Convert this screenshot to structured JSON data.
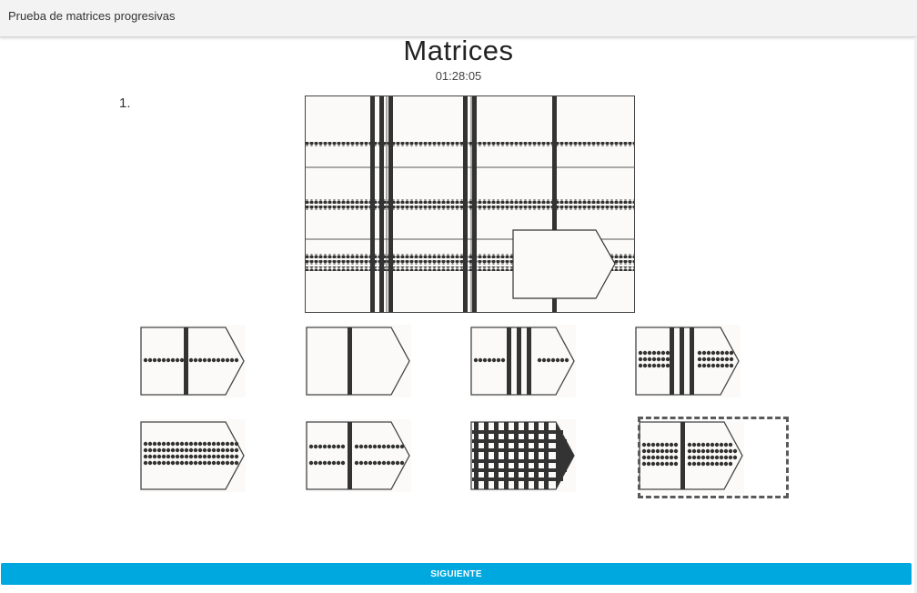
{
  "header": {
    "app_title": "Prueba de matrices progresivas"
  },
  "main": {
    "title": "Matrices",
    "timer": "01:28:05",
    "question_number": "1."
  },
  "options": [
    {
      "position": 1,
      "icon": "option-one-bar-one-dot-row-icon"
    },
    {
      "position": 2,
      "icon": "option-one-bar-no-dots-icon"
    },
    {
      "position": 3,
      "icon": "option-three-bars-one-dot-row-icon"
    },
    {
      "position": 4,
      "icon": "option-three-bars-three-dot-rows-icon"
    },
    {
      "position": 5,
      "icon": "option-no-bars-four-dot-rows-icon"
    },
    {
      "position": 6,
      "icon": "option-one-bar-two-dot-rows-icon"
    },
    {
      "position": 7,
      "icon": "option-many-bars-many-dot-rows-icon"
    },
    {
      "position": 8,
      "icon": "option-one-bar-four-dot-rows-icon",
      "selected": true
    }
  ],
  "footer": {
    "next_label": "SIGUIENTE"
  },
  "colors": {
    "accent": "#00a8e0",
    "ink": "#333333",
    "paper": "#fbfaf8"
  }
}
